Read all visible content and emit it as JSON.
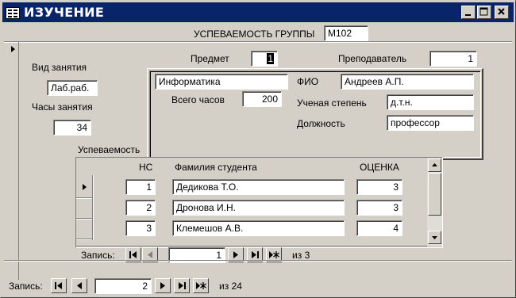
{
  "window": {
    "title": "ИЗУЧЕНИЕ",
    "min_glyph": "_",
    "max_glyph": "□",
    "close_glyph": "✕"
  },
  "form": {
    "header_label": "УСПЕВАЕМОСТЬ ГРУППЫ",
    "group_value": "M102",
    "vid_label": "Вид занятия",
    "vid_value": "Лаб.раб.",
    "hours_label": "Часы занятия",
    "hours_value": "34",
    "subject_label": "Предмет",
    "subject_value": "1",
    "teacher_label": "Преподаватель",
    "teacher_value": "1",
    "subject_name": "Информатика",
    "total_hours_label": "Всего часов",
    "total_hours_value": "200",
    "fio_label": "ФИО",
    "fio_value": "Андреев А.П.",
    "degree_label": "Ученая степень",
    "degree_value": "д.т.н.",
    "position_label": "Должность",
    "position_value": "профессор",
    "progress_label": "Успеваемость"
  },
  "subform": {
    "columns": [
      "НС",
      "Фамилия студента",
      "ОЦЕНКА"
    ],
    "rows": [
      {
        "ns": "1",
        "name": "Дедикова Т.О.",
        "grade": "3"
      },
      {
        "ns": "2",
        "name": "Дронова И.Н.",
        "grade": "3"
      },
      {
        "ns": "3",
        "name": "Клемешов А.В.",
        "grade": "4"
      }
    ],
    "nav_label": "Запись:",
    "nav_current": "1",
    "nav_of": "из",
    "nav_total": "3"
  },
  "main_nav": {
    "label": "Запись:",
    "current": "2",
    "of": "из",
    "total": "24"
  }
}
